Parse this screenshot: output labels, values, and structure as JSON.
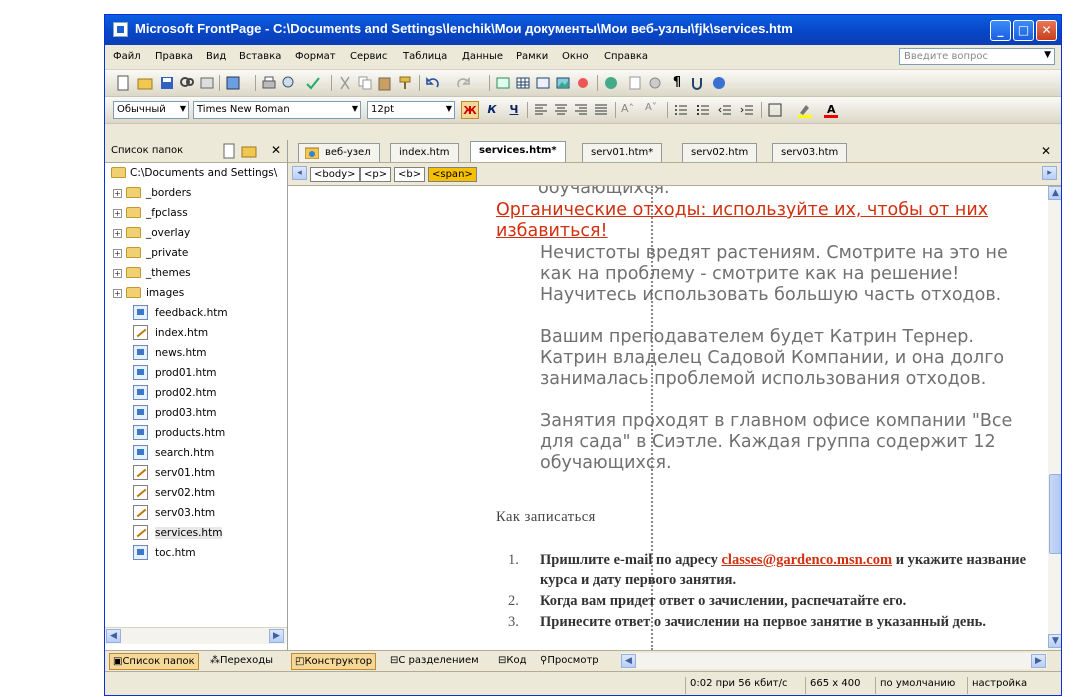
{
  "window": {
    "title": "Microsoft FrontPage - C:\\Documents and Settings\\lenchik\\Мои документы\\Мои веб-узлы\\fjk\\services.htm",
    "min": "_",
    "max": "□",
    "close": "✕"
  },
  "menu": {
    "items": [
      "Файл",
      "Правка",
      "Вид",
      "Вставка",
      "Формат",
      "Сервис",
      "Таблица",
      "Данные",
      "Рамки",
      "Окно",
      "Справка"
    ],
    "ask_placeholder": "Введите вопрос"
  },
  "format_bar": {
    "style": "Обычный",
    "font": "Times New Roman",
    "size": "12pt",
    "bold": "Ж",
    "italic": "К",
    "underline": "Ч"
  },
  "folder_pane": {
    "title": "Список папок",
    "close": "✕",
    "root": "C:\\Documents and Settings\\",
    "folders": [
      "_borders",
      "_fpclass",
      "_overlay",
      "_private",
      "_themes",
      "images"
    ],
    "files": [
      {
        "name": "feedback.htm",
        "icon": "page-icon"
      },
      {
        "name": "index.htm",
        "icon": "edited-page-icon"
      },
      {
        "name": "news.htm",
        "icon": "page-icon"
      },
      {
        "name": "prod01.htm",
        "icon": "page-icon"
      },
      {
        "name": "prod02.htm",
        "icon": "page-icon"
      },
      {
        "name": "prod03.htm",
        "icon": "page-icon"
      },
      {
        "name": "products.htm",
        "icon": "page-icon"
      },
      {
        "name": "search.htm",
        "icon": "page-icon"
      },
      {
        "name": "serv01.htm",
        "icon": "edited-page-icon"
      },
      {
        "name": "serv02.htm",
        "icon": "edited-page-icon"
      },
      {
        "name": "serv03.htm",
        "icon": "edited-page-icon"
      },
      {
        "name": "services.htm",
        "icon": "edited-page-icon",
        "selected": true
      },
      {
        "name": "toc.htm",
        "icon": "page-icon"
      }
    ]
  },
  "doc_tabs": [
    "веб-узел",
    "index.htm",
    "services.htm*",
    "serv01.htm*",
    "serv02.htm",
    "serv03.htm"
  ],
  "active_tab": "services.htm*",
  "quick_tags": [
    "<body>",
    "<p>",
    "<b>",
    "<span>"
  ],
  "content": {
    "partial_top": "обучающихся.",
    "heading": "Органические отходы: используйте их, чтобы от них избавиться!",
    "para1": "Нечистоты вредят растениям. Смотрите на это не как на проблему - смотрите как на решение! Научитесь использовать большую часть отходов.",
    "para2": "Вашим преподавателем будет Катрин Тернер. Катрин владелец Садовой Компании, и она долго занималась проблемой использования отходов.",
    "para3": "Занятия проходят в главном офисе компании \"Все для сада\" в Сиэтле. Каждая группа содержит 12 обучающихся.",
    "subheading": "Как записаться",
    "steps": [
      {
        "num": "1.",
        "before": "Пришлите e-mail по адресу ",
        "link": "classes@gardenco.msn.com",
        "after": " и укажите название курса и дату первого занятия."
      },
      {
        "num": "2.",
        "before": "Когда вам придет ответ о зачислении, распечатайте его.",
        "link": "",
        "after": ""
      },
      {
        "num": "3.",
        "before": "Принесите ответ о зачислении на первое занятие в указанный день.",
        "link": "",
        "after": ""
      }
    ]
  },
  "bottom_tabs_left": [
    "Список папок",
    "Переходы"
  ],
  "view_tabs": [
    "Конструктор",
    "С разделением",
    "Код",
    "Просмотр"
  ],
  "active_view": "Конструктор",
  "status": {
    "speed": "0:02 при 56 кбит/с",
    "size": "665 x 400",
    "default": "по умолчанию",
    "custom": "настройка"
  },
  "colors": {
    "title_blue": "#0a5fe0",
    "heading_red": "#d03010",
    "accent_orange": "#f5c000"
  }
}
